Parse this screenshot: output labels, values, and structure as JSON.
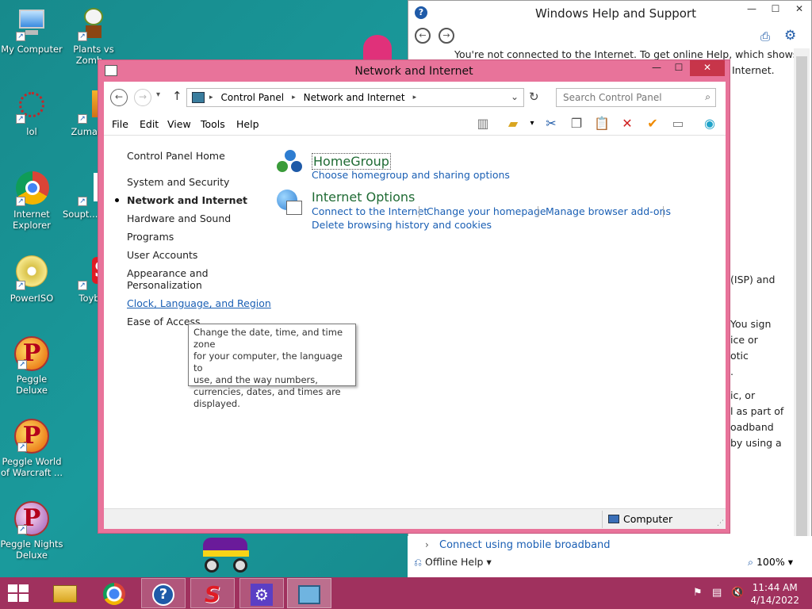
{
  "desktop": {
    "icons": [
      {
        "label": "My Computer"
      },
      {
        "label": "Plants vs Zomb..."
      },
      {
        "label": "lol"
      },
      {
        "label": "Zuma D..."
      },
      {
        "label": "Internet Explorer"
      },
      {
        "label": "Soupt... Plays"
      },
      {
        "label": "PowerISO"
      },
      {
        "label": "Toyb..."
      },
      {
        "label": "Peggle Deluxe"
      },
      {
        "label": "Peggle World of Warcraft ..."
      },
      {
        "label": "Peggle Nights Deluxe"
      }
    ]
  },
  "help_window": {
    "title": "Windows Help and Support",
    "line1": "You're not connected to the Internet. To get online Help, which shows",
    "line2": "Internet.",
    "frag_isp": "(ISP) and",
    "frag_you_sign": "You sign",
    "frag_ice_or": "ice or",
    "frag_otic": "otic",
    "frag_dot": ".",
    "frag_ic_or": "ic, or",
    "frag_part_of": "l as part of",
    "frag_oadband": "oadband",
    "frag_using": "by using a",
    "bottom_link": "Connect using mobile broadband",
    "offline_help": "Offline Help",
    "zoom": "100%"
  },
  "control_panel": {
    "title": "Network and Internet",
    "address": {
      "segments": [
        "Control Panel",
        "Network and Internet"
      ]
    },
    "search_placeholder": "Search Control Panel",
    "menu": [
      "File",
      "Edit",
      "View",
      "Tools",
      "Help"
    ],
    "side": {
      "home": "Control Panel Home",
      "items": [
        "System and Security",
        "Network and Internet",
        "Hardware and Sound",
        "Programs",
        "User Accounts",
        "Appearance and",
        "Personalization",
        "Clock, Language, and Region",
        "Ease of Access"
      ]
    },
    "categories": {
      "homegroup": {
        "title": "HomeGroup",
        "link1": "Choose homegroup and sharing options"
      },
      "internet_options": {
        "title": "Internet Options",
        "link1": "Connect to the Internet",
        "link2": "Change your homepage",
        "link3": "Manage browser add-ons",
        "link4": "Delete browsing history and cookies"
      }
    },
    "tooltip": {
      "l1": "Change the date, time, and time zone",
      "l2": "for your computer, the language to",
      "l3": "use, and the way numbers,",
      "l4": "currencies, dates, and times are",
      "l5": "displayed."
    },
    "status": "Computer"
  },
  "taskbar": {
    "time": "11:44 AM",
    "date": "4/14/2022"
  }
}
